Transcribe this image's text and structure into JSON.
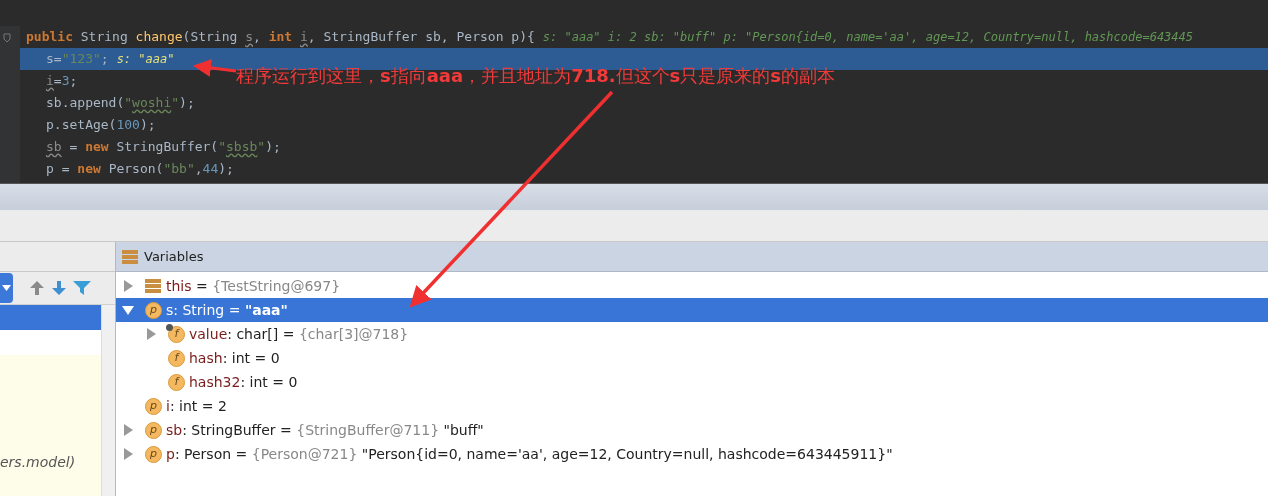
{
  "editor": {
    "lines": [
      {
        "current": false,
        "tokens": [
          {
            "text": "public ",
            "kind": "kw"
          },
          {
            "text": "String ",
            "kind": "plain"
          },
          {
            "text": "change",
            "kind": "method"
          },
          {
            "text": "(String ",
            "kind": "plain"
          },
          {
            "text": "s",
            "kind": "unused"
          },
          {
            "text": ", ",
            "kind": "plain"
          },
          {
            "text": "int ",
            "kind": "kw"
          },
          {
            "text": "i",
            "kind": "unused"
          },
          {
            "text": ", StringBuffer sb, Person p){",
            "kind": "plain"
          }
        ],
        "hint": "s: \"aaa\"  i: 2  sb: \"buff\"  p: \"Person{id=0, name='aa', age=12, Country=null, hashcode=643445"
      },
      {
        "current": true,
        "tokens": [
          {
            "text": "s=",
            "kind": "plain"
          },
          {
            "text": "\"123\"",
            "kind": "str"
          },
          {
            "text": ";",
            "kind": "plain"
          }
        ],
        "hint": "s: \"aaa\""
      },
      {
        "current": false,
        "tokens": [
          {
            "text": "i",
            "kind": "unused"
          },
          {
            "text": "=",
            "kind": "plain"
          },
          {
            "text": "3",
            "kind": "num"
          },
          {
            "text": ";",
            "kind": "plain"
          }
        ]
      },
      {
        "current": false,
        "tokens": [
          {
            "text": "sb.append(",
            "kind": "plain"
          },
          {
            "text": "\"",
            "kind": "str"
          },
          {
            "text": "woshi",
            "kind": "strwarn"
          },
          {
            "text": "\"",
            "kind": "str"
          },
          {
            "text": ");",
            "kind": "plain"
          }
        ]
      },
      {
        "current": false,
        "tokens": [
          {
            "text": "p.setAge(",
            "kind": "plain"
          },
          {
            "text": "100",
            "kind": "num"
          },
          {
            "text": ");",
            "kind": "plain"
          }
        ]
      },
      {
        "current": false,
        "tokens": [
          {
            "text": "sb",
            "kind": "unused"
          },
          {
            "text": " = ",
            "kind": "plain"
          },
          {
            "text": "new ",
            "kind": "kw"
          },
          {
            "text": "StringBuffer(",
            "kind": "plain"
          },
          {
            "text": "\"",
            "kind": "str"
          },
          {
            "text": "sbsb",
            "kind": "strwarn"
          },
          {
            "text": "\"",
            "kind": "str"
          },
          {
            "text": ");",
            "kind": "plain"
          }
        ]
      },
      {
        "current": false,
        "tokens": [
          {
            "text": "p = ",
            "kind": "plain"
          },
          {
            "text": "new ",
            "kind": "kw"
          },
          {
            "text": "Person(",
            "kind": "plain"
          },
          {
            "text": "\"bb\"",
            "kind": "str"
          },
          {
            "text": ",",
            "kind": "plain"
          },
          {
            "text": "44",
            "kind": "num"
          },
          {
            "text": ");",
            "kind": "plain"
          }
        ]
      }
    ]
  },
  "annotation": {
    "text": "程序运行到这里，**s**指向**aaa**，并且地址为**718.**但这个**s**只是原来的**s**的副本"
  },
  "frames_panel": {
    "texts": [
      "ers.model)"
    ]
  },
  "variables_panel": {
    "title": "Variables",
    "items": [
      {
        "kind": "stack",
        "expanded": false,
        "selected": false,
        "parts": [
          {
            "text": "this",
            "kind": "name"
          },
          {
            "text": " = ",
            "kind": "plain"
          },
          {
            "text": "{TestString@697}",
            "kind": "ref"
          }
        ]
      },
      {
        "kind": "badge",
        "badge": "p",
        "expanded": true,
        "selected": true,
        "parts": [
          {
            "text": "s",
            "kind": "name"
          },
          {
            "text": ": String  = ",
            "kind": "plain"
          },
          {
            "text": "\"aaa\"",
            "kind": "value"
          }
        ],
        "children": [
          {
            "kind": "badge",
            "badge": "f",
            "locked": true,
            "expanded": false,
            "selected": false,
            "parts": [
              {
                "text": "value",
                "kind": "name"
              },
              {
                "text": ": char[]  = ",
                "kind": "plain"
              },
              {
                "text": "{char[3]@718}",
                "kind": "ref"
              }
            ]
          },
          {
            "kind": "badge",
            "badge": "f",
            "selected": false,
            "parts": [
              {
                "text": "hash",
                "kind": "name"
              },
              {
                "text": ": int  = 0",
                "kind": "plain"
              }
            ]
          },
          {
            "kind": "badge",
            "badge": "f",
            "selected": false,
            "parts": [
              {
                "text": "hash32",
                "kind": "name"
              },
              {
                "text": ": int  = 0",
                "kind": "plain"
              }
            ]
          }
        ]
      },
      {
        "kind": "badge",
        "badge": "p",
        "selected": false,
        "parts": [
          {
            "text": "i",
            "kind": "name"
          },
          {
            "text": ": int  = 2",
            "kind": "plain"
          }
        ]
      },
      {
        "kind": "badge",
        "badge": "p",
        "expanded": false,
        "selected": false,
        "parts": [
          {
            "text": "sb",
            "kind": "name"
          },
          {
            "text": ": StringBuffer  = ",
            "kind": "plain"
          },
          {
            "text": "{StringBuffer@711}",
            "kind": "ref"
          },
          {
            "text": " \"buff\"",
            "kind": "plain"
          }
        ]
      },
      {
        "kind": "badge",
        "badge": "p",
        "expanded": false,
        "selected": false,
        "parts": [
          {
            "text": "p",
            "kind": "name"
          },
          {
            "text": ": Person  = ",
            "kind": "plain"
          },
          {
            "text": "{Person@721}",
            "kind": "ref"
          },
          {
            "text": " \"Person{id=0, name='aa', age=12, Country=null, hashcode=643445911}\"",
            "kind": "plain"
          }
        ]
      }
    ]
  }
}
